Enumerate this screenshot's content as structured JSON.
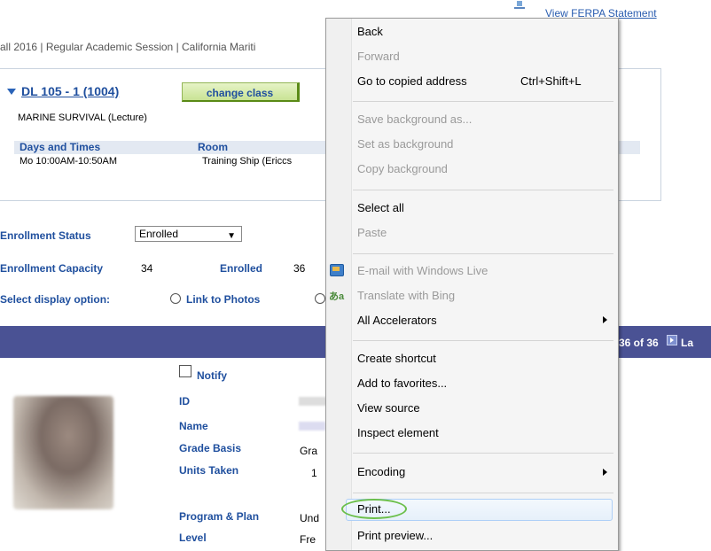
{
  "header": {
    "ferpa_link": "View FERPA Statement"
  },
  "breadcrumb": "all 2016 | Regular Academic Session | California Mariti",
  "class": {
    "code": "DL 105 - 1 (1004)",
    "change_button": "change class",
    "description": "MARINE SURVIVAL (Lecture)",
    "schedule": {
      "headers": [
        "Days and Times",
        "Room"
      ],
      "rows": [
        [
          "Mo 10:00AM-10:50AM",
          "Training Ship (Ericcs"
        ]
      ]
    }
  },
  "enrollment": {
    "status_label": "Enrollment Status",
    "status_value": "Enrolled",
    "capacity_label": "Enrollment Capacity",
    "capacity_value": "34",
    "enrolled_label": "Enrolled",
    "enrolled_value": "36",
    "display_label": "Select display option:",
    "link_to_photos": "Link to Photos"
  },
  "nav": {
    "count": "36 of 36",
    "last": "La"
  },
  "student": {
    "notify_label": "Notify",
    "fields": [
      {
        "label": "ID",
        "value": ""
      },
      {
        "label": "Name",
        "value": ""
      },
      {
        "label": "Grade Basis",
        "value": "Gra"
      },
      {
        "label": "Units Taken",
        "value": "1"
      },
      {
        "label": "Program & Plan",
        "value": "Und"
      },
      {
        "label": "Level",
        "value": "Fre"
      }
    ]
  },
  "context_menu": {
    "items": [
      {
        "label": "Back",
        "disabled": false
      },
      {
        "label": "Forward",
        "disabled": true
      },
      {
        "label": "Go to copied address",
        "shortcut": "Ctrl+Shift+L",
        "disabled": false
      },
      {
        "label": "Save background as...",
        "disabled": true
      },
      {
        "label": "Set as background",
        "disabled": true
      },
      {
        "label": "Copy background",
        "disabled": true
      },
      {
        "label": "Select all",
        "disabled": false
      },
      {
        "label": "Paste",
        "disabled": true
      },
      {
        "label": "E-mail with Windows Live",
        "disabled": true,
        "icon": "windows-live-mail-icon"
      },
      {
        "label": "Translate with Bing",
        "disabled": true,
        "icon": "bing-translate-icon"
      },
      {
        "label": "All Accelerators",
        "disabled": false,
        "submenu": true
      },
      {
        "label": "Create shortcut",
        "disabled": false
      },
      {
        "label": "Add to favorites...",
        "disabled": false
      },
      {
        "label": "View source",
        "disabled": false
      },
      {
        "label": "Inspect element",
        "disabled": false
      },
      {
        "label": "Encoding",
        "disabled": false,
        "submenu": true
      },
      {
        "label": "Print...",
        "disabled": false,
        "highlighted": true
      },
      {
        "label": "Print preview...",
        "disabled": false
      }
    ]
  },
  "colors": {
    "link": "#1f4f9e",
    "nav_bar": "#4a5294",
    "highlight_oval": "#6bbf4a"
  }
}
